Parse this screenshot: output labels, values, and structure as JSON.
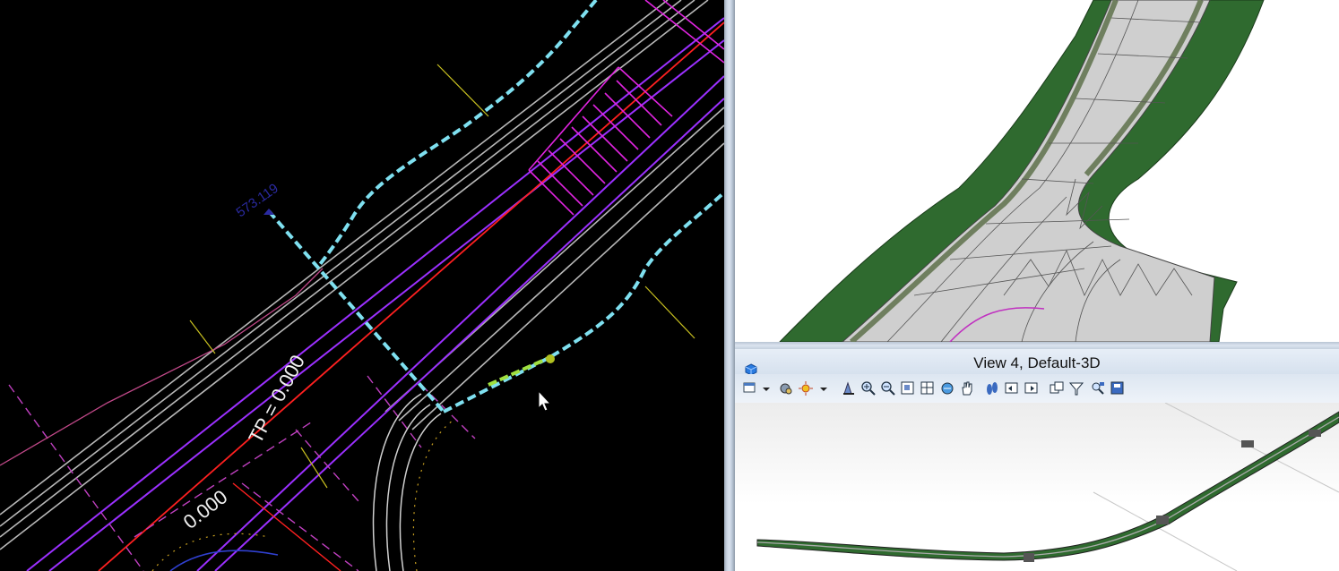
{
  "left_view": {
    "elevation_label": "573.119",
    "tp_label": "TP = 0.000",
    "offset_label": "0.000"
  },
  "view4": {
    "title": "View 4, Default-3D"
  },
  "toolbar_icons": [
    "view-attributes-icon",
    "display-style-icon",
    "view-toolbar-dropdown-icon",
    "update-view-icon",
    "zoom-in-icon",
    "zoom-out-icon",
    "window-area-icon",
    "fit-view-icon",
    "rotate-view-icon",
    "pan-view-icon",
    "walk-icon",
    "previous-view-icon",
    "next-view-icon",
    "copy-view-icon",
    "clip-volume-icon",
    "camera-icon",
    "view-save-icon"
  ],
  "colors": {
    "cad_background": "#000000",
    "cyan_dashed": "#7fe0f0",
    "purple_line": "#9b30ff",
    "red_line": "#ff2020",
    "magenta_hatch": "#e024e0",
    "terrain_green": "#2f6a2f",
    "road_grey": "#cfcfcf"
  }
}
